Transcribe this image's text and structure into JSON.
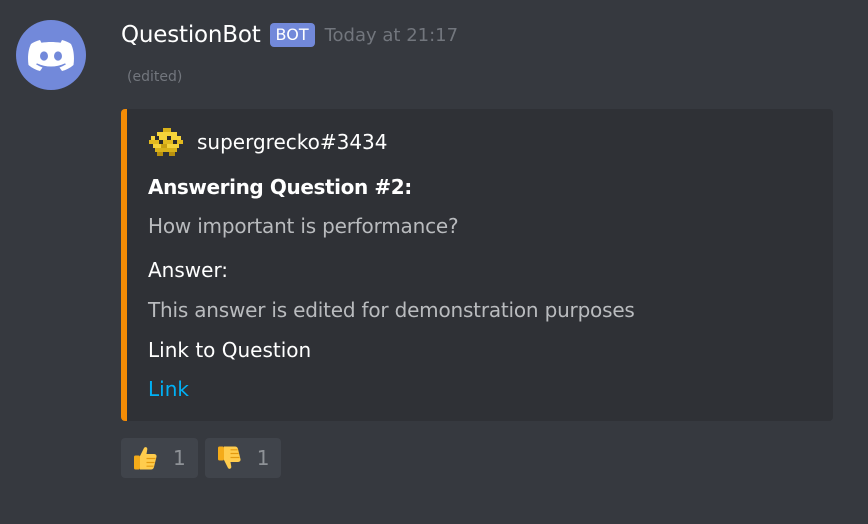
{
  "message": {
    "author": "QuestionBot",
    "bot_tag": "BOT",
    "timestamp": "Today at 21:17",
    "edited": "(edited)",
    "avatar_icon": "discord-logo-icon",
    "avatar_color": "#7289da"
  },
  "embed": {
    "accent_color": "#f48c06",
    "author": {
      "name": "supergrecko#3434",
      "icon": "pixel-avatar-icon"
    },
    "fields": [
      {
        "name": "Answering Question #2:",
        "value": "How important is performance?"
      },
      {
        "name": "Answer:",
        "value": "This answer is edited for demonstration purposes"
      },
      {
        "name": "Link to Question",
        "value": "Link"
      }
    ]
  },
  "reactions": [
    {
      "emoji": "thumbs-up-icon",
      "count": "1"
    },
    {
      "emoji": "thumbs-down-icon",
      "count": "1"
    }
  ]
}
